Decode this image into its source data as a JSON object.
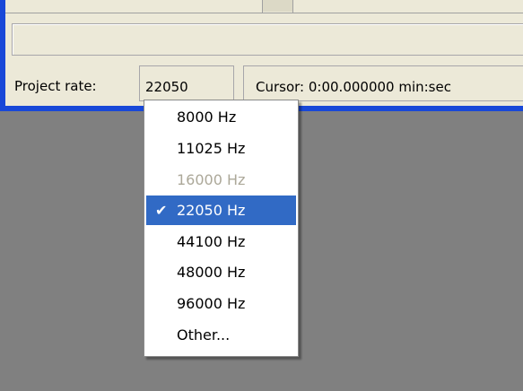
{
  "status": {
    "project_rate_label": "Project rate:",
    "project_rate_value": "22050",
    "cursor_text": "Cursor: 0:00.000000 min:sec"
  },
  "menu": {
    "check_glyph": "✔",
    "items": [
      {
        "label": "8000 Hz",
        "state": "normal"
      },
      {
        "label": "11025 Hz",
        "state": "normal"
      },
      {
        "label": "16000 Hz",
        "state": "disabled"
      },
      {
        "label": "22050 Hz",
        "state": "selected"
      },
      {
        "label": "44100 Hz",
        "state": "normal"
      },
      {
        "label": "48000 Hz",
        "state": "normal"
      },
      {
        "label": "96000 Hz",
        "state": "normal"
      },
      {
        "label": "Other...",
        "state": "normal"
      }
    ]
  },
  "colors": {
    "window_border": "#1848d8",
    "panel_bg": "#ece9d8",
    "selection_bg": "#316ac5",
    "disabled_text": "#aca899",
    "desktop_bg": "#808080"
  }
}
